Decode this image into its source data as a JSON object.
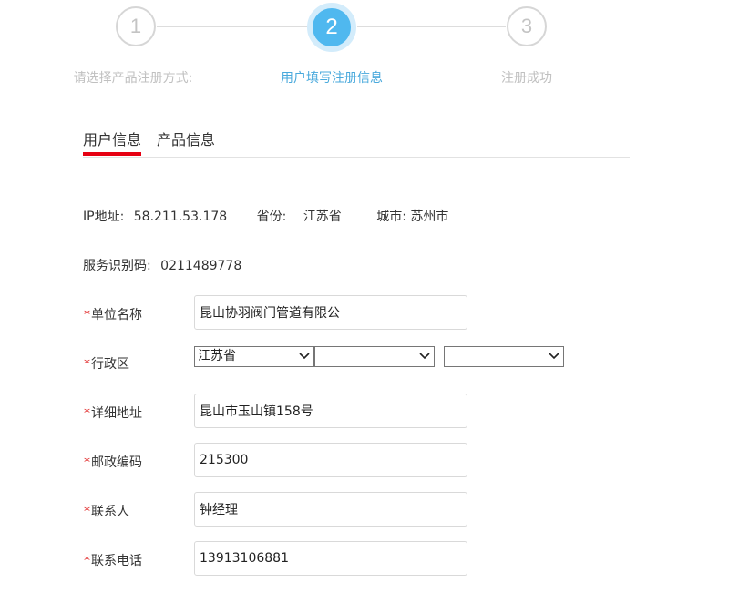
{
  "stepper": {
    "steps": [
      {
        "number": "1",
        "label": "请选择产品注册方式:"
      },
      {
        "number": "2",
        "label": "用户填写注册信息"
      },
      {
        "number": "3",
        "label": "注册成功"
      }
    ],
    "active_step": 2,
    "colors": {
      "active": "#4fb8ef",
      "active_label": "#49a9dc",
      "inactive": "#c4c4c4"
    }
  },
  "tabs": [
    {
      "label": "用户信息",
      "active": true
    },
    {
      "label": "产品信息",
      "active": false
    }
  ],
  "tab_accent_color": "#e60012",
  "info": {
    "ip_label": "IP地址:",
    "ip_value": "58.211.53.178",
    "province_label": "省份:",
    "province_value": "江苏省",
    "city_label": "城市:",
    "city_value": "苏州市",
    "service_code_label": "服务识别码:",
    "service_code_value": "0211489778"
  },
  "form": {
    "required_mark": "*",
    "company_name": {
      "label": "单位名称",
      "value": "昆山协羽阀门管道有限公",
      "placeholder": ""
    },
    "region": {
      "label": "行政区",
      "province_selected": "江苏省",
      "city_selected": "",
      "district_selected": ""
    },
    "address": {
      "label": "详细地址",
      "value": "昆山市玉山镇158号",
      "placeholder": ""
    },
    "postcode": {
      "label": "邮政编码",
      "value": "215300",
      "placeholder": ""
    },
    "contact": {
      "label": "联系人",
      "value": "钟经理",
      "placeholder": ""
    },
    "phone": {
      "label": "联系电话",
      "value": "13913106881",
      "placeholder": ""
    }
  }
}
